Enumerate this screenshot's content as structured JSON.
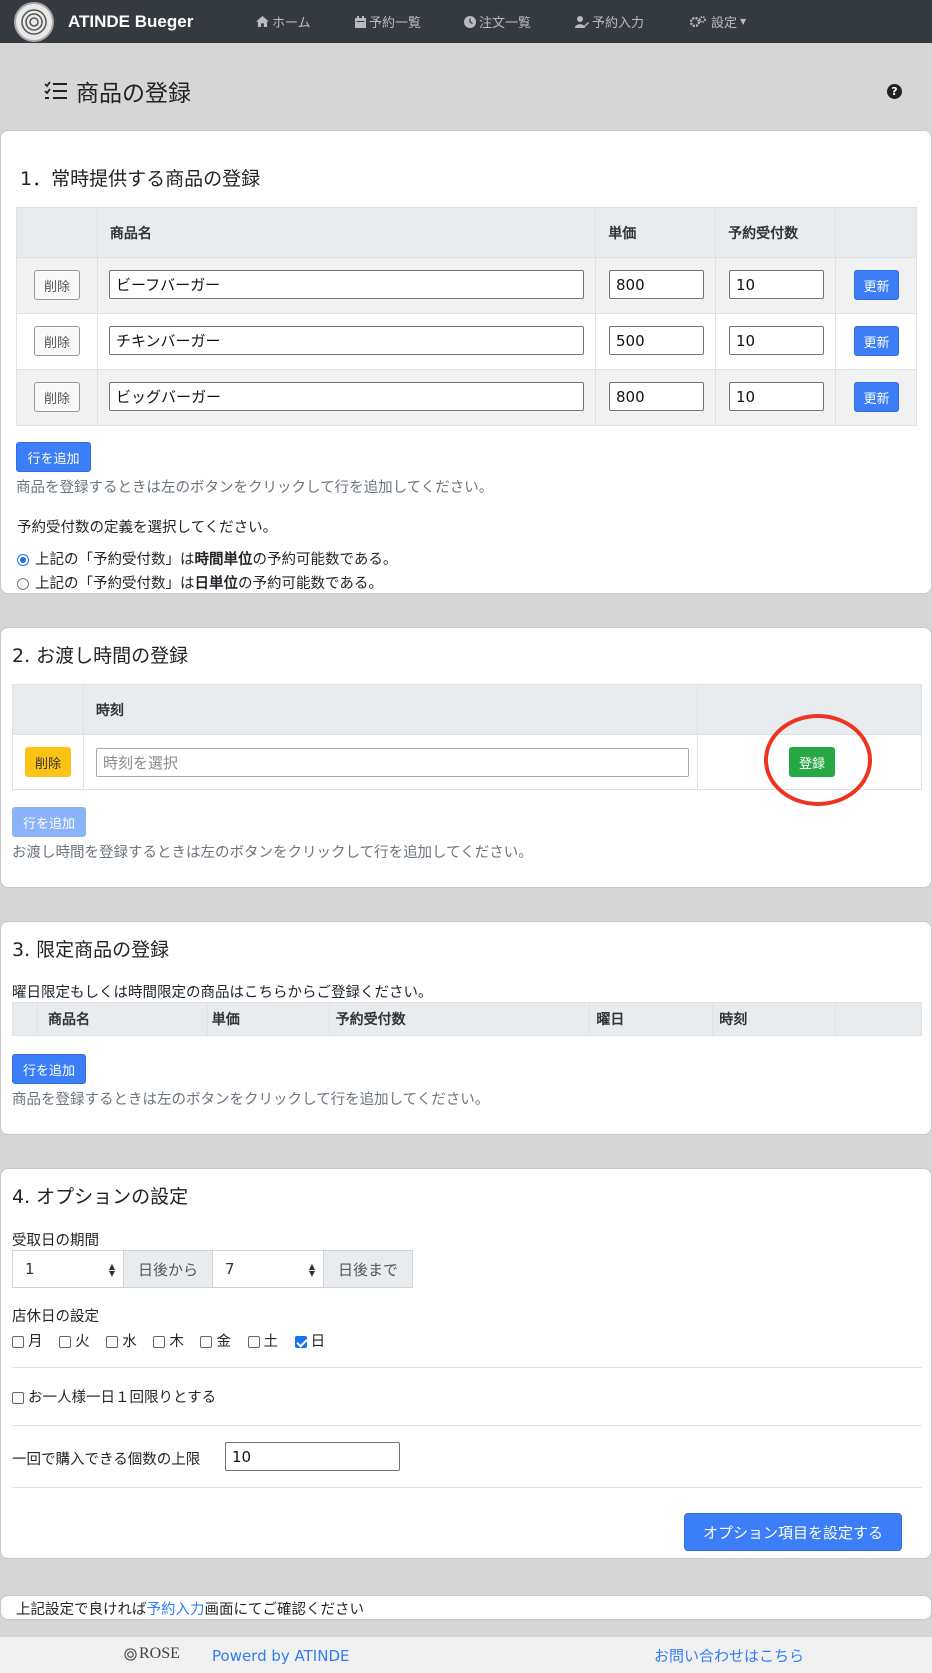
{
  "navbar": {
    "brand": "ATINDE Bueger",
    "items": [
      {
        "icon": "home-icon",
        "label": "ホーム"
      },
      {
        "icon": "calendar-icon",
        "label": "予約一覧"
      },
      {
        "icon": "clock-icon",
        "label": "注文一覧"
      },
      {
        "icon": "user-edit-icon",
        "label": "予約入力"
      },
      {
        "icon": "cogs-icon",
        "label": "設定"
      }
    ]
  },
  "page": {
    "title": "商品の登録",
    "help": "?"
  },
  "section1": {
    "title": "1．常時提供する商品の登録",
    "headers": [
      "商品名",
      "単価",
      "予約受付数"
    ],
    "rows": [
      {
        "delete": "削除",
        "name": "ビーフバーガー",
        "price": "800",
        "qty": "10",
        "update": "更新"
      },
      {
        "delete": "削除",
        "name": "チキンバーガー",
        "price": "500",
        "qty": "10",
        "update": "更新"
      },
      {
        "delete": "削除",
        "name": "ビッグバーガー",
        "price": "800",
        "qty": "10",
        "update": "更新"
      }
    ],
    "add_row": "行を追加",
    "hint": "商品を登録するときは左のボタンをクリックして行を追加してください。",
    "definition_prompt": "予約受付数の定義を選択してください。",
    "option1": {
      "pre": "上記の「予約受付数」は",
      "bold": "時間単位",
      "post": "の予約可能数である。"
    },
    "option2": {
      "pre": "上記の「予約受付数」は",
      "bold": "日単位",
      "post": "の予約可能数である。"
    }
  },
  "section2": {
    "title": "2. お渡し時間の登録",
    "header_time": "時刻",
    "delete": "削除",
    "time_placeholder": "時刻を選択",
    "register": "登録",
    "add_row": "行を追加",
    "hint": "お渡し時間を登録するときは左のボタンをクリックして行を追加してください。"
  },
  "section3": {
    "title": "3. 限定商品の登録",
    "intro": "曜日限定もしくは時間限定の商品はこちらからご登録ください。",
    "headers": [
      "商品名",
      "単価",
      "予約受付数",
      "曜日",
      "時刻"
    ],
    "add_row": "行を追加",
    "hint": "商品を登録するときは左のボタンをクリックして行を追加してください。"
  },
  "section4": {
    "title": "4. オプションの設定",
    "period_label": "受取日の期間",
    "from_value": "1",
    "from_suffix": "日後から",
    "to_value": "7",
    "to_suffix": "日後まで",
    "holiday_label": "店休日の設定",
    "days": [
      {
        "label": "月",
        "checked": false
      },
      {
        "label": "火",
        "checked": false
      },
      {
        "label": "水",
        "checked": false
      },
      {
        "label": "木",
        "checked": false
      },
      {
        "label": "金",
        "checked": false
      },
      {
        "label": "土",
        "checked": false
      },
      {
        "label": "日",
        "checked": true
      }
    ],
    "once_per_day": "お一人様一日１回限りとする",
    "limit_label": "一回で購入できる個数の上限",
    "limit_value": "10",
    "submit": "オプション項目を設定する"
  },
  "note": {
    "pre": "上記設定で良ければ",
    "link": "予約入力",
    "post": "画面にてご確認ください"
  },
  "footer": {
    "rose": "ROSE",
    "powered": "Powerd by ATINDE",
    "contact": "お問い合わせはこちら"
  },
  "colors": {
    "navbar": "#343a40",
    "primary": "#3b7ef7",
    "success": "#28a745",
    "warning": "#fbc316",
    "annotation": "#ee3322"
  }
}
